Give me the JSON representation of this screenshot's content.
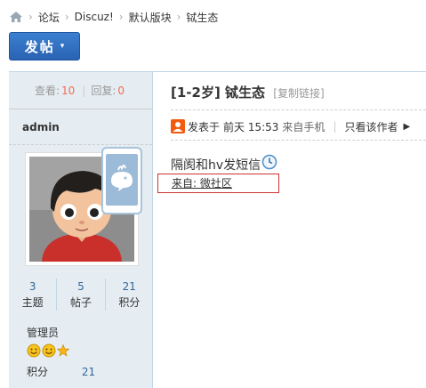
{
  "breadcrumb": {
    "home_icon": "home-icon",
    "items": [
      "论坛",
      "Discuz!",
      "默认版块",
      "铽生态"
    ]
  },
  "toolbar": {
    "post_label": "发帖",
    "post_caret": "▾"
  },
  "thread": {
    "stats": {
      "views_label": "查看:",
      "views": "10",
      "replies_label": "回复:",
      "replies": "0"
    },
    "title": "[1-2岁] 铽生态",
    "copy_link": "[复制链接]"
  },
  "user": {
    "name": "admin",
    "counts": [
      {
        "value": "3",
        "label": "主题"
      },
      {
        "value": "5",
        "label": "帖子"
      },
      {
        "value": "21",
        "label": "积分"
      }
    ],
    "role": "管理员",
    "points_label": "积分",
    "points_value": "21"
  },
  "post": {
    "posted_prefix": "发表于",
    "time": "前天 15:53",
    "from_mobile": "来自手机",
    "only_author": "只看该作者",
    "content": "隔阂和hv发短信",
    "mobile_source": "来自: 微社区"
  },
  "colors": {
    "accent": "#2a63b3",
    "number": "#f26c4f",
    "link": "#336699",
    "sidebar": "#e5edf2",
    "highlight": "#cc3333"
  }
}
